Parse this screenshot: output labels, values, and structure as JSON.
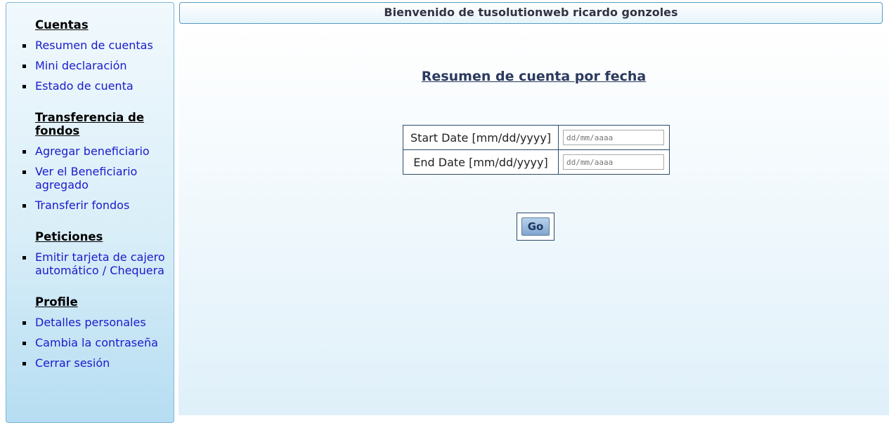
{
  "sidebar": {
    "sections": [
      {
        "heading": "Cuentas",
        "items": [
          {
            "label": "Resumen de cuentas"
          },
          {
            "label": "Mini declaración"
          },
          {
            "label": "Estado de cuenta"
          }
        ]
      },
      {
        "heading": "Transferencia de fondos",
        "items": [
          {
            "label": "Agregar beneficiario"
          },
          {
            "label": "Ver el Beneficiario agregado"
          },
          {
            "label": "Transferir fondos"
          }
        ]
      },
      {
        "heading": "Peticiones",
        "items": [
          {
            "label": "Emitir tarjeta de cajero automático / Chequera"
          }
        ]
      },
      {
        "heading": "Profile",
        "items": [
          {
            "label": "Detalles personales"
          },
          {
            "label": "Cambia la contraseña"
          },
          {
            "label": "Cerrar sesión"
          }
        ]
      }
    ]
  },
  "header": {
    "welcome": "Bienvenido de tusolutionweb ricardo gonzoles"
  },
  "main": {
    "title": "Resumen de cuenta por fecha",
    "start_label": "Start Date [mm/dd/yyyy]",
    "start_placeholder": "dd/mm/aaaa",
    "end_label": "End Date [mm/dd/yyyy]",
    "end_placeholder": "dd/mm/aaaa",
    "go_label": "Go"
  }
}
